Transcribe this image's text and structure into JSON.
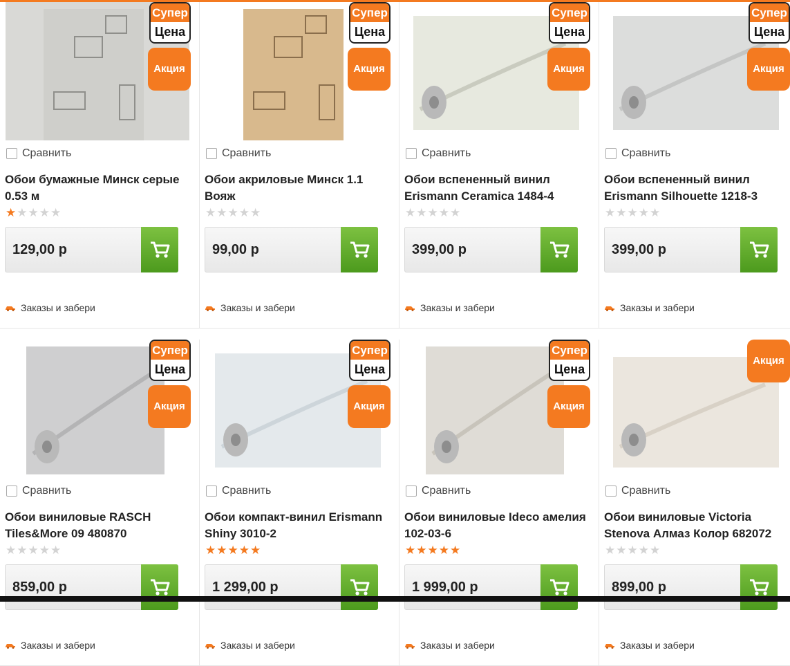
{
  "compare_label": "Сравнить",
  "badges": {
    "super_top": "Супер",
    "super_bottom": "Цена",
    "sale": "Акция"
  },
  "delivery_label": "Заказы и забери",
  "colors": {
    "accent": "#f47a20",
    "cart_green": "#5da82a"
  },
  "products": [
    {
      "title": "Обои бумажные Минск серые 0.53 м",
      "price": "129,00 р",
      "rating": 1,
      "super_price": true,
      "sale": true,
      "image": "paper-wallpaper-grey"
    },
    {
      "title": "Обои акриловые Минск 1.1 Вояж",
      "price": "99,00 р",
      "rating": 0,
      "super_price": true,
      "sale": true,
      "image": "acrylic-wallpaper-beige"
    },
    {
      "title": "Обои вспененный винил Erismann Ceramica 1484-4",
      "price": "399,00 р",
      "rating": 0,
      "super_price": true,
      "sale": true,
      "image": "vinyl-roll-tiles"
    },
    {
      "title": "Обои вспененный винил Erismann Silhouette 1218-3",
      "price": "399,00 р",
      "rating": 0,
      "super_price": true,
      "sale": true,
      "image": "vinyl-roll-grey"
    },
    {
      "title": "Обои виниловые RASCH Tiles&More 09 480870",
      "price": "859,00 р",
      "rating": 0,
      "super_price": true,
      "sale": true,
      "image": "vinyl-roll-light-grey"
    },
    {
      "title": "Обои компакт-винил Erismann Shiny 3010-2",
      "price": "1 299,00 р",
      "rating": 5,
      "super_price": true,
      "sale": true,
      "image": "vinyl-roll-floral"
    },
    {
      "title": "Обои виниловые Ideco амелия 102-03-6",
      "price": "1 999,00 р",
      "rating": 5,
      "super_price": true,
      "sale": true,
      "image": "vinyl-roll-damask"
    },
    {
      "title": "Обои виниловые Victoria Stenova Алмаз Колор 682072",
      "price": "899,00 р",
      "rating": 0,
      "super_price": false,
      "sale": true,
      "image": "vinyl-roll-plain"
    }
  ]
}
